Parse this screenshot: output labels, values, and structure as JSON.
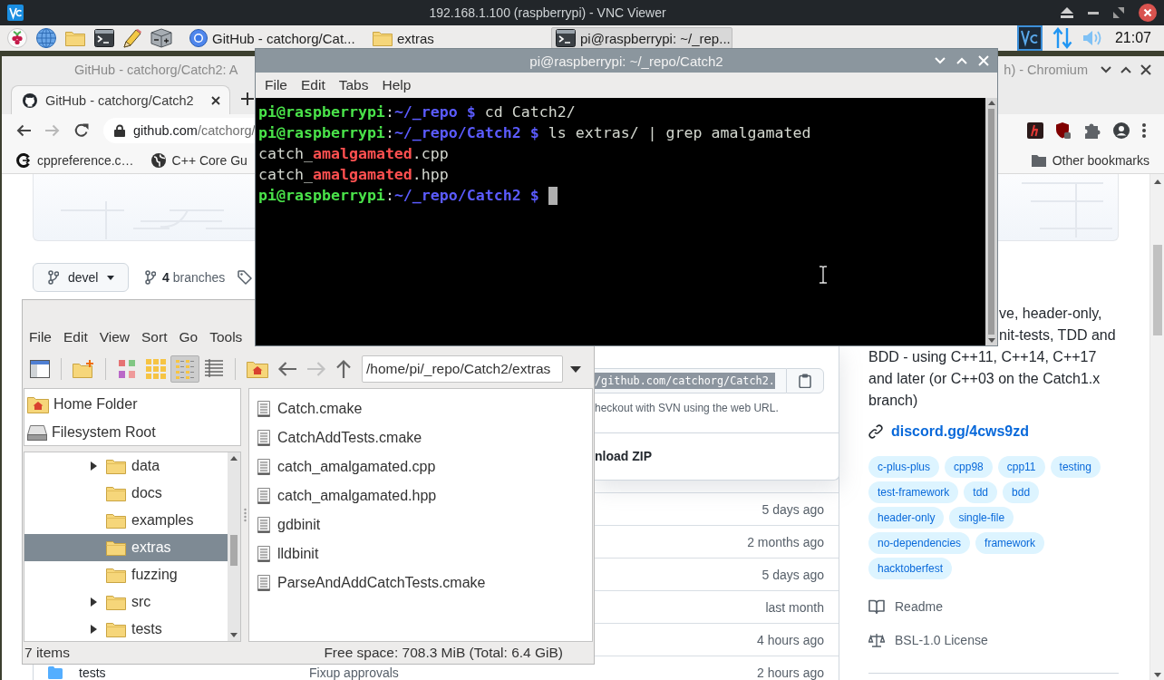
{
  "vnc": {
    "title": "192.168.1.100 (raspberrypi) - VNC Viewer"
  },
  "taskbar": {
    "tasks": [
      {
        "label": "GitHub - catchorg/Cat...",
        "kind": "browser",
        "selected": false
      },
      {
        "label": "extras",
        "kind": "folder",
        "selected": false
      },
      {
        "label": "pi@raspberrypi: ~/_rep...",
        "kind": "terminal",
        "selected": true
      }
    ],
    "clock": "21:07"
  },
  "browser": {
    "title_left": "GitHub - catchorg/Catch2: A",
    "title_right": "h) - Chromium",
    "tabs": [
      {
        "label": "GitHub - catchorg/Catch2",
        "selected": true
      }
    ],
    "forward_disabled": true,
    "url": {
      "host": "github.com",
      "path": "/catchorg/"
    },
    "bookmarks": [
      {
        "label": "cppreference.c…",
        "kind": "site"
      },
      {
        "label": "C++ Core Gu",
        "kind": "globe"
      }
    ],
    "other_bookmarks": "Other bookmarks",
    "page": {
      "branch": "devel",
      "branches": "**4** branches",
      "clone": {
        "url": "/github.com/catchorg/Catch2.",
        "hint": "heckout with SVN using the web URL.",
        "download": "nload ZIP"
      },
      "rows": [
        {
          "time": "5 days ago"
        },
        {
          "time": "2 months ago"
        },
        {
          "time": "5 days ago"
        },
        {
          "time": "last month"
        },
        {
          "time": "4 hours ago"
        },
        {
          "name": "tests",
          "message": "Fixup approvals",
          "time": "2 hours ago"
        }
      ],
      "about_lines": [
        "ve, header-only,",
        "nit-tests, TDD and",
        "BDD - using C++11, C++14, C++17",
        "and later (or C++03 on the Catch1.x",
        "branch)"
      ],
      "link": "discord.gg/4cws9zd",
      "topics": [
        "c-plus-plus",
        "cpp98",
        "cpp11",
        "testing",
        "test-framework",
        "tdd",
        "bdd",
        "header-only",
        "single-file",
        "no-dependencies",
        "framework",
        "hacktoberfest"
      ],
      "readme": "Readme",
      "license": "BSL-1.0 License"
    }
  },
  "file_manager": {
    "menu": [
      "File",
      "Edit",
      "View",
      "Sort",
      "Go",
      "Tools"
    ],
    "view_buttons": [
      {
        "kind": "icons",
        "selected": false
      },
      {
        "kind": "thumbnails",
        "selected": false
      },
      {
        "kind": "compact",
        "selected": true
      },
      {
        "kind": "list",
        "selected": false
      }
    ],
    "forward_disabled": true,
    "path": "/home/pi/_repo/Catch2/extras",
    "places": [
      {
        "label": "Home Folder",
        "kind": "home"
      },
      {
        "label": "Filesystem Root",
        "kind": "drive"
      }
    ],
    "tree": [
      {
        "label": "data",
        "expandable": true,
        "selected": false
      },
      {
        "label": "docs",
        "expandable": false,
        "selected": false
      },
      {
        "label": "examples",
        "expandable": false,
        "selected": false
      },
      {
        "label": "extras",
        "expandable": false,
        "selected": true
      },
      {
        "label": "fuzzing",
        "expandable": false,
        "selected": false
      },
      {
        "label": "src",
        "expandable": true,
        "selected": false
      },
      {
        "label": "tests",
        "expandable": true,
        "selected": false
      }
    ],
    "files": [
      "Catch.cmake",
      "CatchAddTests.cmake",
      "catch_amalgamated.cpp",
      "catch_amalgamated.hpp",
      "gdbinit",
      "lldbinit",
      "ParseAndAddCatchTests.cmake"
    ],
    "status": "7 items",
    "free_space": "Free space: 708.3 MiB (Total: 6.4 GiB)"
  },
  "terminal": {
    "title": "pi@raspberrypi: ~/_repo/Catch2",
    "menu": [
      "File",
      "Edit",
      "Tabs",
      "Help"
    ],
    "lines": [
      {
        "segments": [
          {
            "text": "pi@raspberrypi",
            "kind": "user"
          },
          {
            "text": ":",
            "kind": "plain"
          },
          {
            "text": "~/_repo $",
            "kind": "path"
          },
          {
            "text": " cd Catch2/",
            "kind": "plain"
          }
        ]
      },
      {
        "segments": [
          {
            "text": "pi@raspberrypi",
            "kind": "user"
          },
          {
            "text": ":",
            "kind": "plain"
          },
          {
            "text": "~/_repo/Catch2 $",
            "kind": "path"
          },
          {
            "text": " ls extras/ | grep amalgamated",
            "kind": "plain"
          }
        ]
      },
      {
        "segments": [
          {
            "text": "catch_",
            "kind": "plain"
          },
          {
            "text": "amalgamated",
            "kind": "match"
          },
          {
            "text": ".cpp",
            "kind": "plain"
          }
        ]
      },
      {
        "segments": [
          {
            "text": "catch_",
            "kind": "plain"
          },
          {
            "text": "amalgamated",
            "kind": "match"
          },
          {
            "text": ".hpp",
            "kind": "plain"
          }
        ]
      },
      {
        "segments": [
          {
            "text": "pi@raspberrypi",
            "kind": "user"
          },
          {
            "text": ":",
            "kind": "plain"
          },
          {
            "text": "~/_repo/Catch2 $",
            "kind": "path"
          }
        ]
      }
    ]
  }
}
